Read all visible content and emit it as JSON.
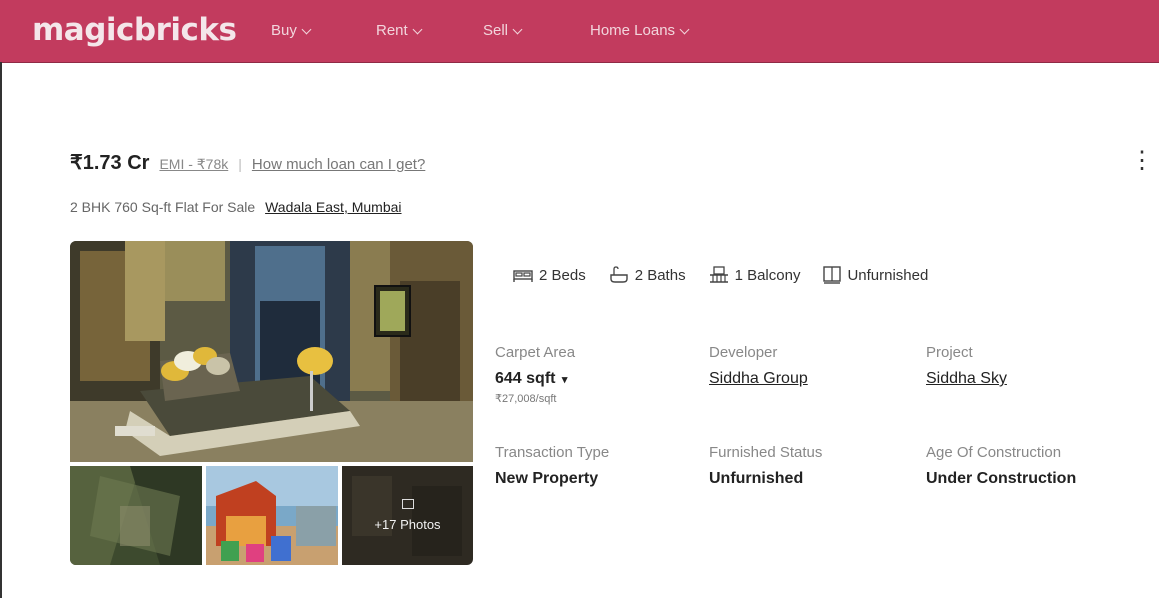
{
  "brand": {
    "logo": "magicbricks",
    "color": "#c23b5e"
  },
  "nav": [
    {
      "label": "Buy"
    },
    {
      "label": "Rent"
    },
    {
      "label": "Sell"
    },
    {
      "label": "Home Loans"
    }
  ],
  "listing": {
    "price": "₹1.73 Cr",
    "emi": "EMI - ₹78k",
    "separator": "|",
    "loan_link": "How much loan can I get?",
    "title": "2 BHK 760 Sq-ft Flat For Sale",
    "locality": "Wadala East, Mumbai",
    "more_icon": "more-vertical-icon",
    "photos_label": "+17 Photos",
    "amenities": [
      {
        "icon": "bed-icon",
        "label": "2 Beds"
      },
      {
        "icon": "bath-icon",
        "label": "2 Baths"
      },
      {
        "icon": "balcony-icon",
        "label": "1 Balcony"
      },
      {
        "icon": "wardrobe-icon",
        "label": "Unfurnished"
      }
    ],
    "details": [
      {
        "label": "Carpet Area",
        "value": "644 sqft",
        "sub": "₹27,008/sqft"
      },
      {
        "label": "Developer",
        "value": "Siddha Group"
      },
      {
        "label": "Project",
        "value": "Siddha Sky"
      },
      {
        "label": "Transaction Type",
        "value": "New Property"
      },
      {
        "label": "Furnished Status",
        "value": "Unfurnished"
      },
      {
        "label": "Age Of Construction",
        "value": "Under Construction"
      }
    ]
  }
}
